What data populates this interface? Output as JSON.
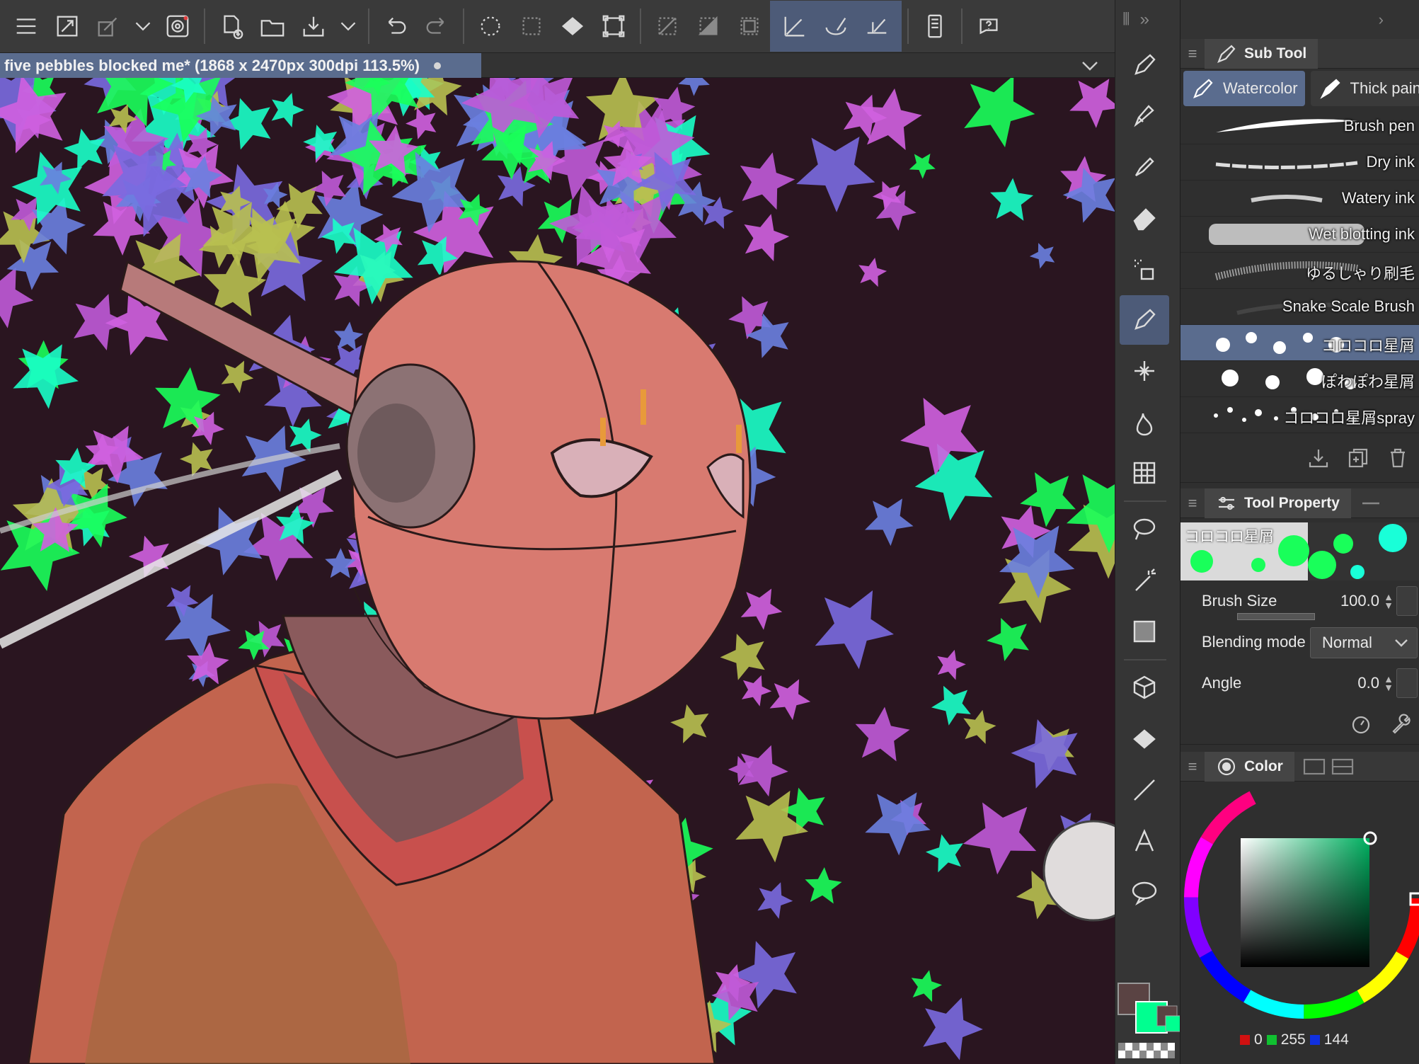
{
  "toolbar": {
    "buttons": [
      "menu-icon",
      "resize-icon",
      "link-icon",
      "chevron-down-icon",
      "spiral-icon",
      "new-document-icon",
      "open-folder-icon",
      "save-icon",
      "chevron-down-icon",
      "undo-icon",
      "redo-icon",
      "selection-dots-icon",
      "select-all-icon",
      "fill-icon",
      "transform-icon",
      "deselect-icon",
      "invert-icon",
      "selection-border-icon",
      "ruler-icon",
      "brush-snap-icon",
      "pen-ruler-icon",
      "tablet-icon",
      "help-icon"
    ]
  },
  "document": {
    "title": "five pebbles blocked me* (1868 x 2470px 300dpi 113.5%)"
  },
  "subtool_panel": {
    "title": "Sub Tool",
    "tabs": [
      {
        "label": "Watercolor",
        "active": true
      },
      {
        "label": "Thick pain",
        "active": false
      }
    ],
    "brushes": [
      {
        "name": "Brush pen"
      },
      {
        "name": "Dry ink"
      },
      {
        "name": "Watery ink"
      },
      {
        "name": "Wet blotting ink"
      },
      {
        "name": "ゆるしゃり刷毛"
      },
      {
        "name": "Snake Scale Brush"
      },
      {
        "name": "コロコロ星屑",
        "selected": true
      },
      {
        "name": "ぽわぽわ星屑"
      },
      {
        "name": "コロコロ星屑spray"
      }
    ]
  },
  "tool_property": {
    "title": "Tool Property",
    "preview_label": "コロコロ星屑",
    "brush_size_label": "Brush Size",
    "brush_size": "100.0",
    "blending_label": "Blending mode",
    "blending": "Normal",
    "angle_label": "Angle",
    "angle": "0.0"
  },
  "color_panel": {
    "title": "Color",
    "r": "0",
    "g": "255",
    "b": "144",
    "current_color": "#00ff90"
  },
  "colors": {
    "accent": "#5a6c8e",
    "panel": "#2f2f2f",
    "canvas_bg": "#2a1520"
  }
}
